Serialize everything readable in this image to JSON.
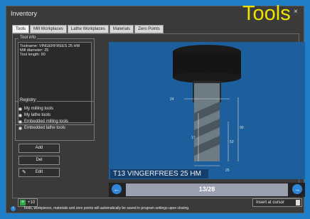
{
  "window": {
    "title": "Inventory",
    "big_title": "Tools",
    "close_glyph": "×"
  },
  "tabs": [
    {
      "label": "Tools",
      "active": true
    },
    {
      "label": "Mill Workplaces",
      "active": false
    },
    {
      "label": "Lathe Workplaces",
      "active": false
    },
    {
      "label": "Materials",
      "active": false
    },
    {
      "label": "Zero Points",
      "active": false
    }
  ],
  "tool_info": {
    "legend": "Tool info",
    "lines": [
      "Toolname: VINGERFREES 25 HM",
      "Mill diameter: 25",
      "Tool length: 90"
    ]
  },
  "registry": {
    "legend": "Registry",
    "items": [
      "My milling tools",
      "My lathe tools",
      "Embedded milling tools",
      "Embedded lathe tools"
    ]
  },
  "buttons": {
    "add": "Add",
    "del": "Del",
    "edit": "Edit",
    "plus_label": "+10",
    "insert": "Insert at cursor"
  },
  "viewer": {
    "caption": "T13 VINGERFREES 25 HM",
    "dims": {
      "top_width": "24",
      "height_a": "17",
      "height_b": "53",
      "height_c": "90",
      "bottom_width": "25"
    }
  },
  "nav": {
    "counter": "13/28",
    "prev_glyph": "←",
    "next_glyph": "→"
  },
  "status": {
    "text": "Tools, workpieces, materials and zero points will automatically be saved in program settings upon closing.",
    "icon": "i"
  },
  "colors": {
    "background": "#1e7fc8",
    "viewer": "#1c5f9c",
    "title_accent": "#f2e200",
    "nav_arrow": "#2f86d8"
  }
}
